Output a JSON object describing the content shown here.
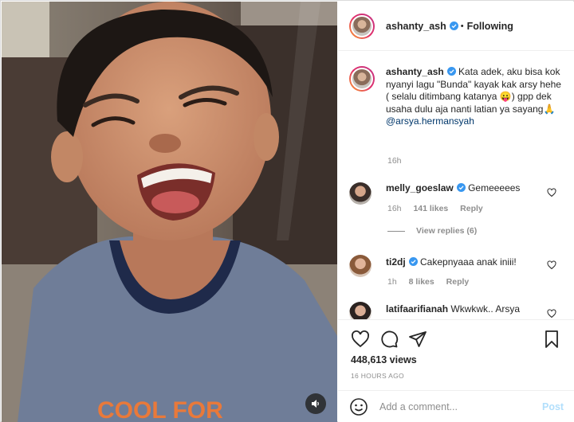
{
  "post": {
    "author": "ashanty_ash",
    "follow_status": "Following",
    "separator": "•"
  },
  "caption": {
    "username": "ashanty_ash",
    "text": "Kata adek, aku bisa kok nyanyi lagu \"Bunda\" kayak kak arsy hehe ( selalu ditimbang katanya 😛) gpp dek usaha dulu aja nanti latian ya sayang🙏",
    "mention": "@arsya.hermansyah",
    "time": "16h"
  },
  "comments": [
    {
      "username": "melly_goeslaw",
      "verified": true,
      "text": "Gemeeeees",
      "time": "16h",
      "likes": "141 likes",
      "reply": "Reply",
      "view_replies": "View replies (6)"
    },
    {
      "username": "ti2dj",
      "verified": true,
      "text": "Cakepnyaaa anak iniii!",
      "time": "1h",
      "likes": "8 likes",
      "reply": "Reply"
    },
    {
      "username": "latifaarifianah",
      "verified": false,
      "text": "Wkwkwk.. Arsya"
    }
  ],
  "stats": {
    "views": "448,613 views",
    "time_ago": "16 HOURS AGO"
  },
  "composer": {
    "placeholder": "Add a comment...",
    "post_label": "Post"
  },
  "icons": {
    "verified": "verified-badge-icon",
    "like": "heart-icon",
    "comment": "speech-bubble-icon",
    "share": "paper-plane-icon",
    "save": "bookmark-icon",
    "emoji": "smiley-icon",
    "mute": "speaker-icon"
  },
  "colors": {
    "verified_blue": "#3897f0",
    "link_blue": "#00376b",
    "post_disabled": "#b2dffc",
    "shirt": "#6f7d98"
  }
}
